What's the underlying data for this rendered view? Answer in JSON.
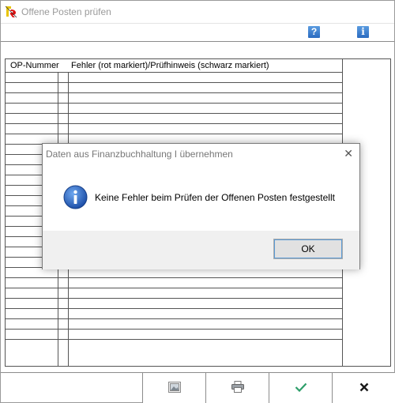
{
  "window": {
    "title": "Offene Posten prüfen"
  },
  "toolbar": {
    "help_icon_glyph": "?",
    "info_icon_glyph": "i"
  },
  "grid": {
    "columns": [
      {
        "label": "OP-Nummer"
      },
      {
        "label": ""
      },
      {
        "label": "Fehler (rot markiert)/Prüfhinweis (schwarz markiert)"
      }
    ],
    "row_count": 26
  },
  "bottom_bar": {
    "buttons": [
      "preview-icon",
      "printer-icon",
      "checkmark-icon",
      "cross-icon"
    ],
    "colors": {
      "check": "#2e9e6a",
      "cross": "#1a1a1a"
    }
  },
  "dialog": {
    "title": "Daten aus Finanzbuchhaltung I übernehmen",
    "close_glyph": "✕",
    "message": "Keine Fehler beim Prüfen der Offenen Posten festgestellt",
    "ok_label": "OK"
  },
  "colors": {
    "accent": "#2a6bc0",
    "dialog_footer": "#f0f0f0"
  }
}
